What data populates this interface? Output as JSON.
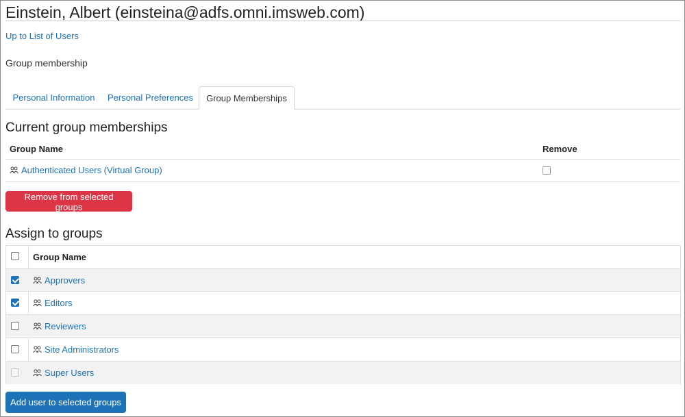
{
  "page": {
    "title": "Einstein, Albert (einsteina@adfs.omni.imsweb.com)",
    "up_link": "Up to List of Users",
    "subheading": "Group membership"
  },
  "tabs": [
    {
      "label": "Personal Information",
      "active": false
    },
    {
      "label": "Personal Preferences",
      "active": false
    },
    {
      "label": "Group Memberships",
      "active": true
    }
  ],
  "current": {
    "heading": "Current group memberships",
    "col_group": "Group Name",
    "col_remove": "Remove",
    "rows": [
      {
        "name": "Authenticated Users (Virtual Group)",
        "remove_checked": false
      }
    ],
    "remove_button": "Remove from selected groups"
  },
  "assign": {
    "heading": "Assign to groups",
    "col_group": "Group Name",
    "select_all_checked": false,
    "rows": [
      {
        "name": "Approvers",
        "checked": true,
        "disabled": false
      },
      {
        "name": "Editors",
        "checked": true,
        "disabled": false
      },
      {
        "name": "Reviewers",
        "checked": false,
        "disabled": false
      },
      {
        "name": "Site Administrators",
        "checked": false,
        "disabled": false
      },
      {
        "name": "Super Users",
        "checked": false,
        "disabled": true
      }
    ],
    "add_button": "Add user to selected groups"
  },
  "icons": {
    "group": "users-group-icon"
  },
  "colors": {
    "link": "#1d72b8",
    "danger": "#dc3545",
    "primary": "#1d72b8"
  }
}
